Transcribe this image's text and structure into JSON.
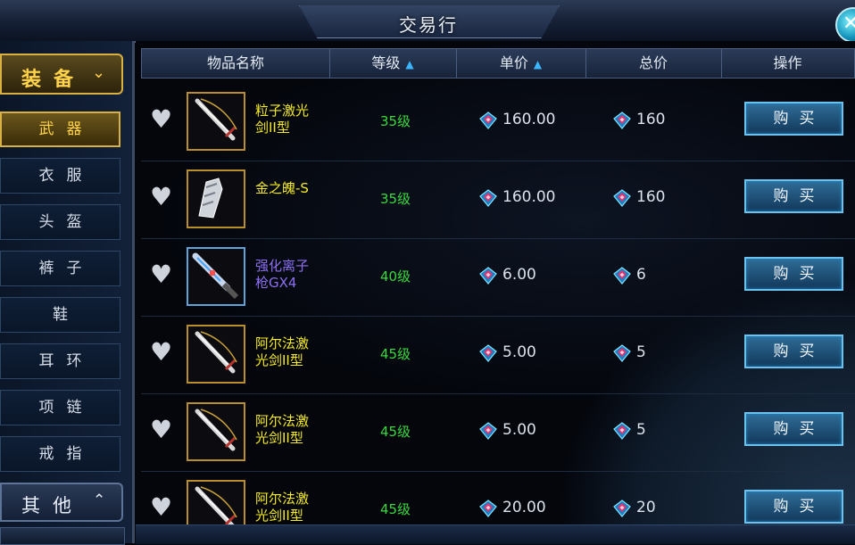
{
  "window": {
    "title": "交易行",
    "close_icon": "close-icon"
  },
  "sidebar": {
    "main_category": "装备",
    "subcategories": [
      "武器",
      "衣服",
      "头盔",
      "裤子",
      "鞋",
      "耳环",
      "项链",
      "戒指"
    ],
    "active_index": 0,
    "other_category": "其他"
  },
  "table": {
    "headers": {
      "name": "物品名称",
      "level": "等级",
      "unit_price": "单价",
      "total_price": "总价",
      "action": "操作"
    },
    "rows": [
      {
        "name_line1": "粒子激光",
        "name_line2": "剑II型",
        "level": "35级",
        "unit_price": "160.00",
        "total_price": "160",
        "buy": "购买",
        "quality": "yellow"
      },
      {
        "name_line1": "金之魄-S",
        "name_line2": "",
        "level": "35级",
        "unit_price": "160.00",
        "total_price": "160",
        "buy": "购买",
        "quality": "yellow"
      },
      {
        "name_line1": "强化离子",
        "name_line2": "枪GX4",
        "level": "40级",
        "unit_price": "6.00",
        "total_price": "6",
        "buy": "购买",
        "quality": "purple"
      },
      {
        "name_line1": "阿尔法激",
        "name_line2": "光剑II型",
        "level": "45级",
        "unit_price": "5.00",
        "total_price": "5",
        "buy": "购买",
        "quality": "yellow"
      },
      {
        "name_line1": "阿尔法激",
        "name_line2": "光剑II型",
        "level": "45级",
        "unit_price": "5.00",
        "total_price": "5",
        "buy": "购买",
        "quality": "yellow"
      },
      {
        "name_line1": "阿尔法激",
        "name_line2": "光剑II型",
        "level": "45级",
        "unit_price": "20.00",
        "total_price": "20",
        "buy": "购买",
        "quality": "yellow"
      }
    ]
  },
  "colors": {
    "accent_gold": "#d9b044",
    "level_green": "#3bd93f",
    "name_yellow": "#f4ea25",
    "name_purple": "#8d6ff2",
    "buy_blue": "#2f6d98"
  }
}
